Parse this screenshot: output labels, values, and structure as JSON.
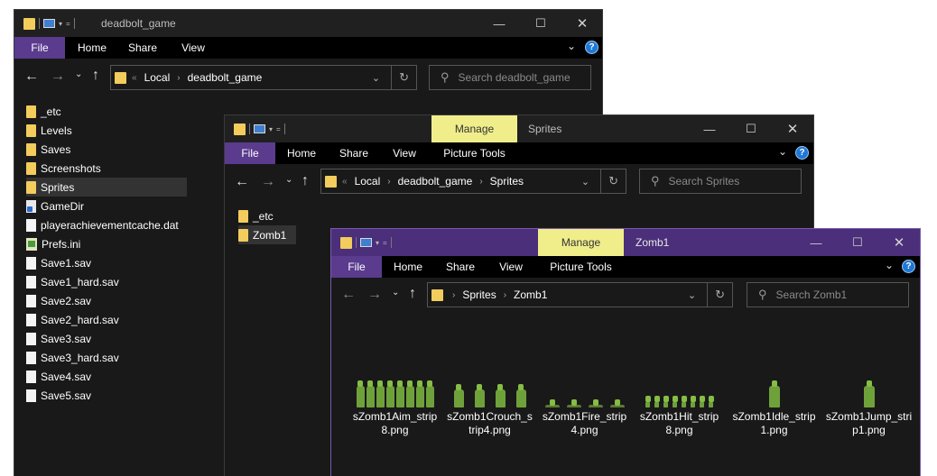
{
  "win1": {
    "title": "deadbolt_game",
    "tabs": {
      "file": "File",
      "home": "Home",
      "share": "Share",
      "view": "View"
    },
    "breadcrumbs": [
      "Local",
      "deadbolt_game"
    ],
    "search_placeholder": "Search deadbolt_game",
    "files": [
      {
        "name": "_etc",
        "icon": "folder-icon"
      },
      {
        "name": "Levels",
        "icon": "folder-icon"
      },
      {
        "name": "Saves",
        "icon": "folder-icon"
      },
      {
        "name": "Screenshots",
        "icon": "folder-icon"
      },
      {
        "name": "Sprites",
        "icon": "folder-icon",
        "selected": true
      },
      {
        "name": "GameDir",
        "icon": "settings-file-icon"
      },
      {
        "name": "playerachievementcache.dat",
        "icon": "file-icon"
      },
      {
        "name": "Prefs.ini",
        "icon": "ini-file-icon"
      },
      {
        "name": "Save1.sav",
        "icon": "file-icon"
      },
      {
        "name": "Save1_hard.sav",
        "icon": "file-icon"
      },
      {
        "name": "Save2.sav",
        "icon": "file-icon"
      },
      {
        "name": "Save2_hard.sav",
        "icon": "file-icon"
      },
      {
        "name": "Save3.sav",
        "icon": "file-icon"
      },
      {
        "name": "Save3_hard.sav",
        "icon": "file-icon"
      },
      {
        "name": "Save4.sav",
        "icon": "file-icon"
      },
      {
        "name": "Save5.sav",
        "icon": "file-icon"
      }
    ]
  },
  "win2": {
    "title": "Sprites",
    "manage": "Manage",
    "tabs": {
      "file": "File",
      "home": "Home",
      "share": "Share",
      "view": "View",
      "picture_tools": "Picture Tools"
    },
    "breadcrumbs": [
      "Local",
      "deadbolt_game",
      "Sprites"
    ],
    "search_placeholder": "Search Sprites",
    "files": [
      {
        "name": "_etc",
        "icon": "folder-icon"
      },
      {
        "name": "Zomb1",
        "icon": "folder-icon",
        "selected": true
      }
    ]
  },
  "win3": {
    "title": "Zomb1",
    "manage": "Manage",
    "tabs": {
      "file": "File",
      "home": "Home",
      "share": "Share",
      "view": "View",
      "picture_tools": "Picture Tools"
    },
    "breadcrumbs": [
      "Sprites",
      "Zomb1"
    ],
    "search_placeholder": "Search Zomb1",
    "thumbnails": [
      "sZomb1Aim_strip8.png",
      "sZomb1Crouch_strip4.png",
      "sZomb1Fire_strip4.png",
      "sZomb1Hit_strip8.png",
      "sZomb1Idle_strip1.png",
      "sZomb1Jump_strip1.png"
    ]
  },
  "help_label": "?",
  "colors": {
    "accent": "#5a3b8e",
    "manage": "#f0ee8a",
    "folder": "#f2cc5c",
    "sprite": "#6fa13a"
  }
}
